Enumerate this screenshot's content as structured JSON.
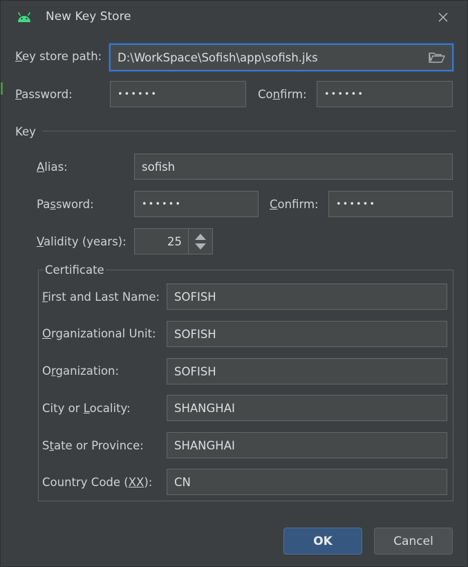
{
  "window": {
    "title": "New Key Store"
  },
  "keystore": {
    "path_label_pre": "",
    "path_label_u": "K",
    "path_label_post": "ey store path:",
    "path_value": "D:\\WorkSpace\\Sofish\\app\\sofish.jks",
    "password_label_u": "P",
    "password_label_post": "assword:",
    "password_value": "••••••",
    "confirm_label_pre": "Co",
    "confirm_label_u": "n",
    "confirm_label_post": "firm:",
    "confirm_value": "••••••"
  },
  "key": {
    "section_label": "Key",
    "alias_label_u": "A",
    "alias_label_post": "lias:",
    "alias_value": "sofish",
    "password_label_pre": "Pa",
    "password_label_u": "s",
    "password_label_post": "sword:",
    "password_value": "••••••",
    "confirm_label_u": "C",
    "confirm_label_post": "onfirm:",
    "confirm_value": "••••••",
    "validity_label_u": "V",
    "validity_label_post": "alidity (years):",
    "validity_value": "25"
  },
  "certificate": {
    "title": "Certificate",
    "first_last_label_u": "F",
    "first_last_label_post": "irst and Last Name:",
    "first_last_value": "SOFISH",
    "org_unit_label_u": "O",
    "org_unit_label_post": "rganizational Unit:",
    "org_unit_value": "SOFISH",
    "org_label_pre": "O",
    "org_label_u": "r",
    "org_label_post": "ganization:",
    "org_value": "SOFISH",
    "city_label_pre": "City or ",
    "city_label_u": "L",
    "city_label_post": "ocality:",
    "city_value": "SHANGHAI",
    "state_label_pre": "S",
    "state_label_u": "t",
    "state_label_post": "ate or Province:",
    "state_value": "SHANGHAI",
    "country_label_pre": "Country Code (",
    "country_label_u": "XX",
    "country_label_post": "):",
    "country_value": "CN"
  },
  "buttons": {
    "ok": "OK",
    "cancel": "Cancel"
  },
  "colors": {
    "accent": "#3d77c7",
    "android_green": "#3ddc84"
  }
}
